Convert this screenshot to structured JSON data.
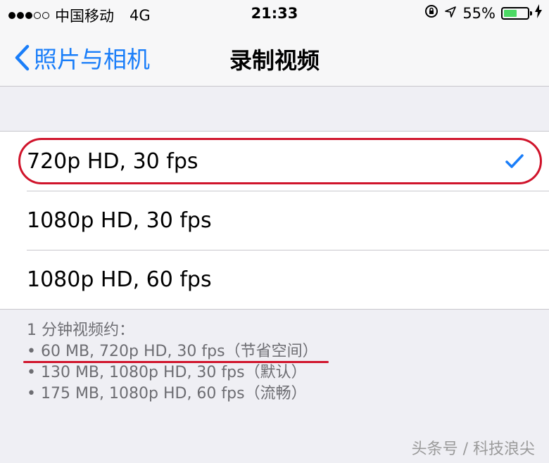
{
  "status_bar": {
    "carrier": "中国移动",
    "network": "4G",
    "time": "21:33",
    "battery": "55%",
    "battery_fraction": 0.55,
    "signal_bars_filled": 3,
    "signal_bars_total": 5
  },
  "nav": {
    "back_label": "照片与相机",
    "title": "录制视频"
  },
  "options": [
    {
      "label": "720p HD, 30 fps",
      "selected": true
    },
    {
      "label": "1080p HD, 30 fps",
      "selected": false
    },
    {
      "label": "1080p HD, 60 fps",
      "selected": false
    }
  ],
  "footer": {
    "heading": "1 分钟视频约：",
    "lines": [
      "• 60 MB, 720p HD, 30 fps（节省空间）",
      "• 130 MB, 1080p HD, 30 fps（默认）",
      "• 175 MB, 1080p HD, 60 fps（流畅）"
    ]
  },
  "watermark": "头条号 / 科技浪尖",
  "colors": {
    "accent": "#1a7ef9",
    "highlight": "#d0142b",
    "battery_fill": "#4cd964"
  }
}
